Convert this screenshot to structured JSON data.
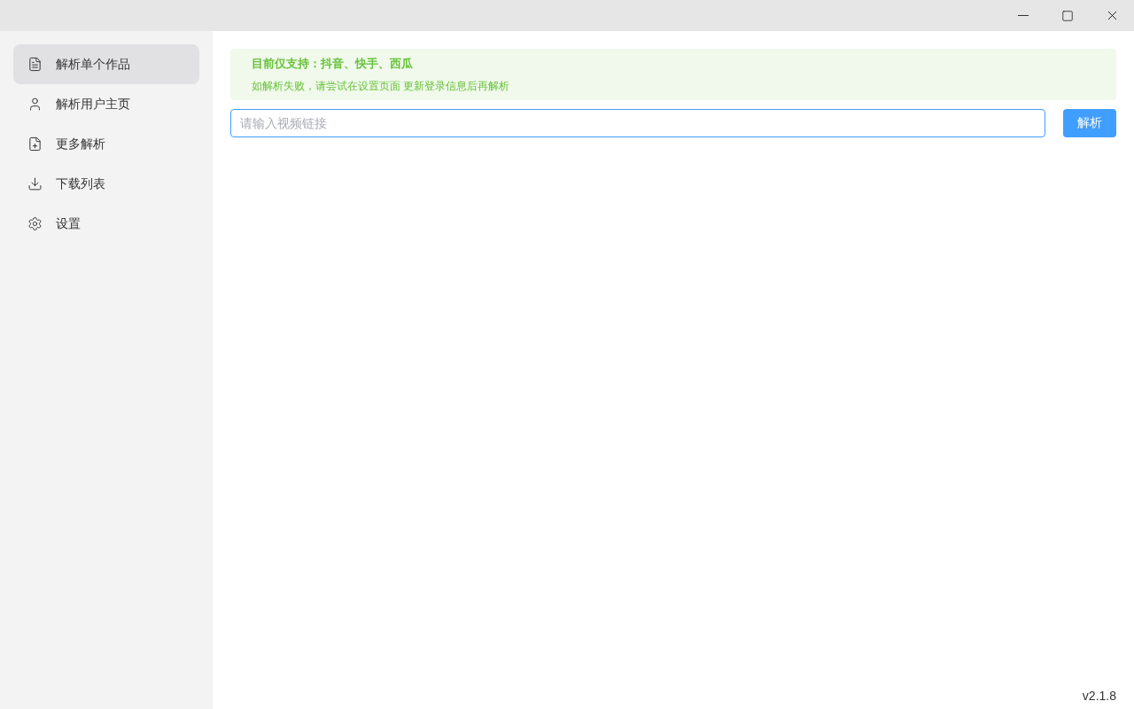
{
  "sidebar": {
    "items": [
      {
        "label": "解析单个作品",
        "kind": "single",
        "selected": true
      },
      {
        "label": "解析用户主页",
        "kind": "user",
        "selected": false
      },
      {
        "label": "更多解析",
        "kind": "more",
        "selected": false
      },
      {
        "label": "下载列表",
        "kind": "downloads",
        "selected": false
      },
      {
        "label": "设置",
        "kind": "settings",
        "selected": false
      }
    ]
  },
  "notice": {
    "title": "目前仅支持：抖音、快手、西瓜",
    "text": "如解析失败，请尝试在设置页面 更新登录信息后再解析"
  },
  "url_field": {
    "placeholder": "请输入视频链接",
    "focused": true
  },
  "parse_button": "解析",
  "version": "v2.1.8"
}
